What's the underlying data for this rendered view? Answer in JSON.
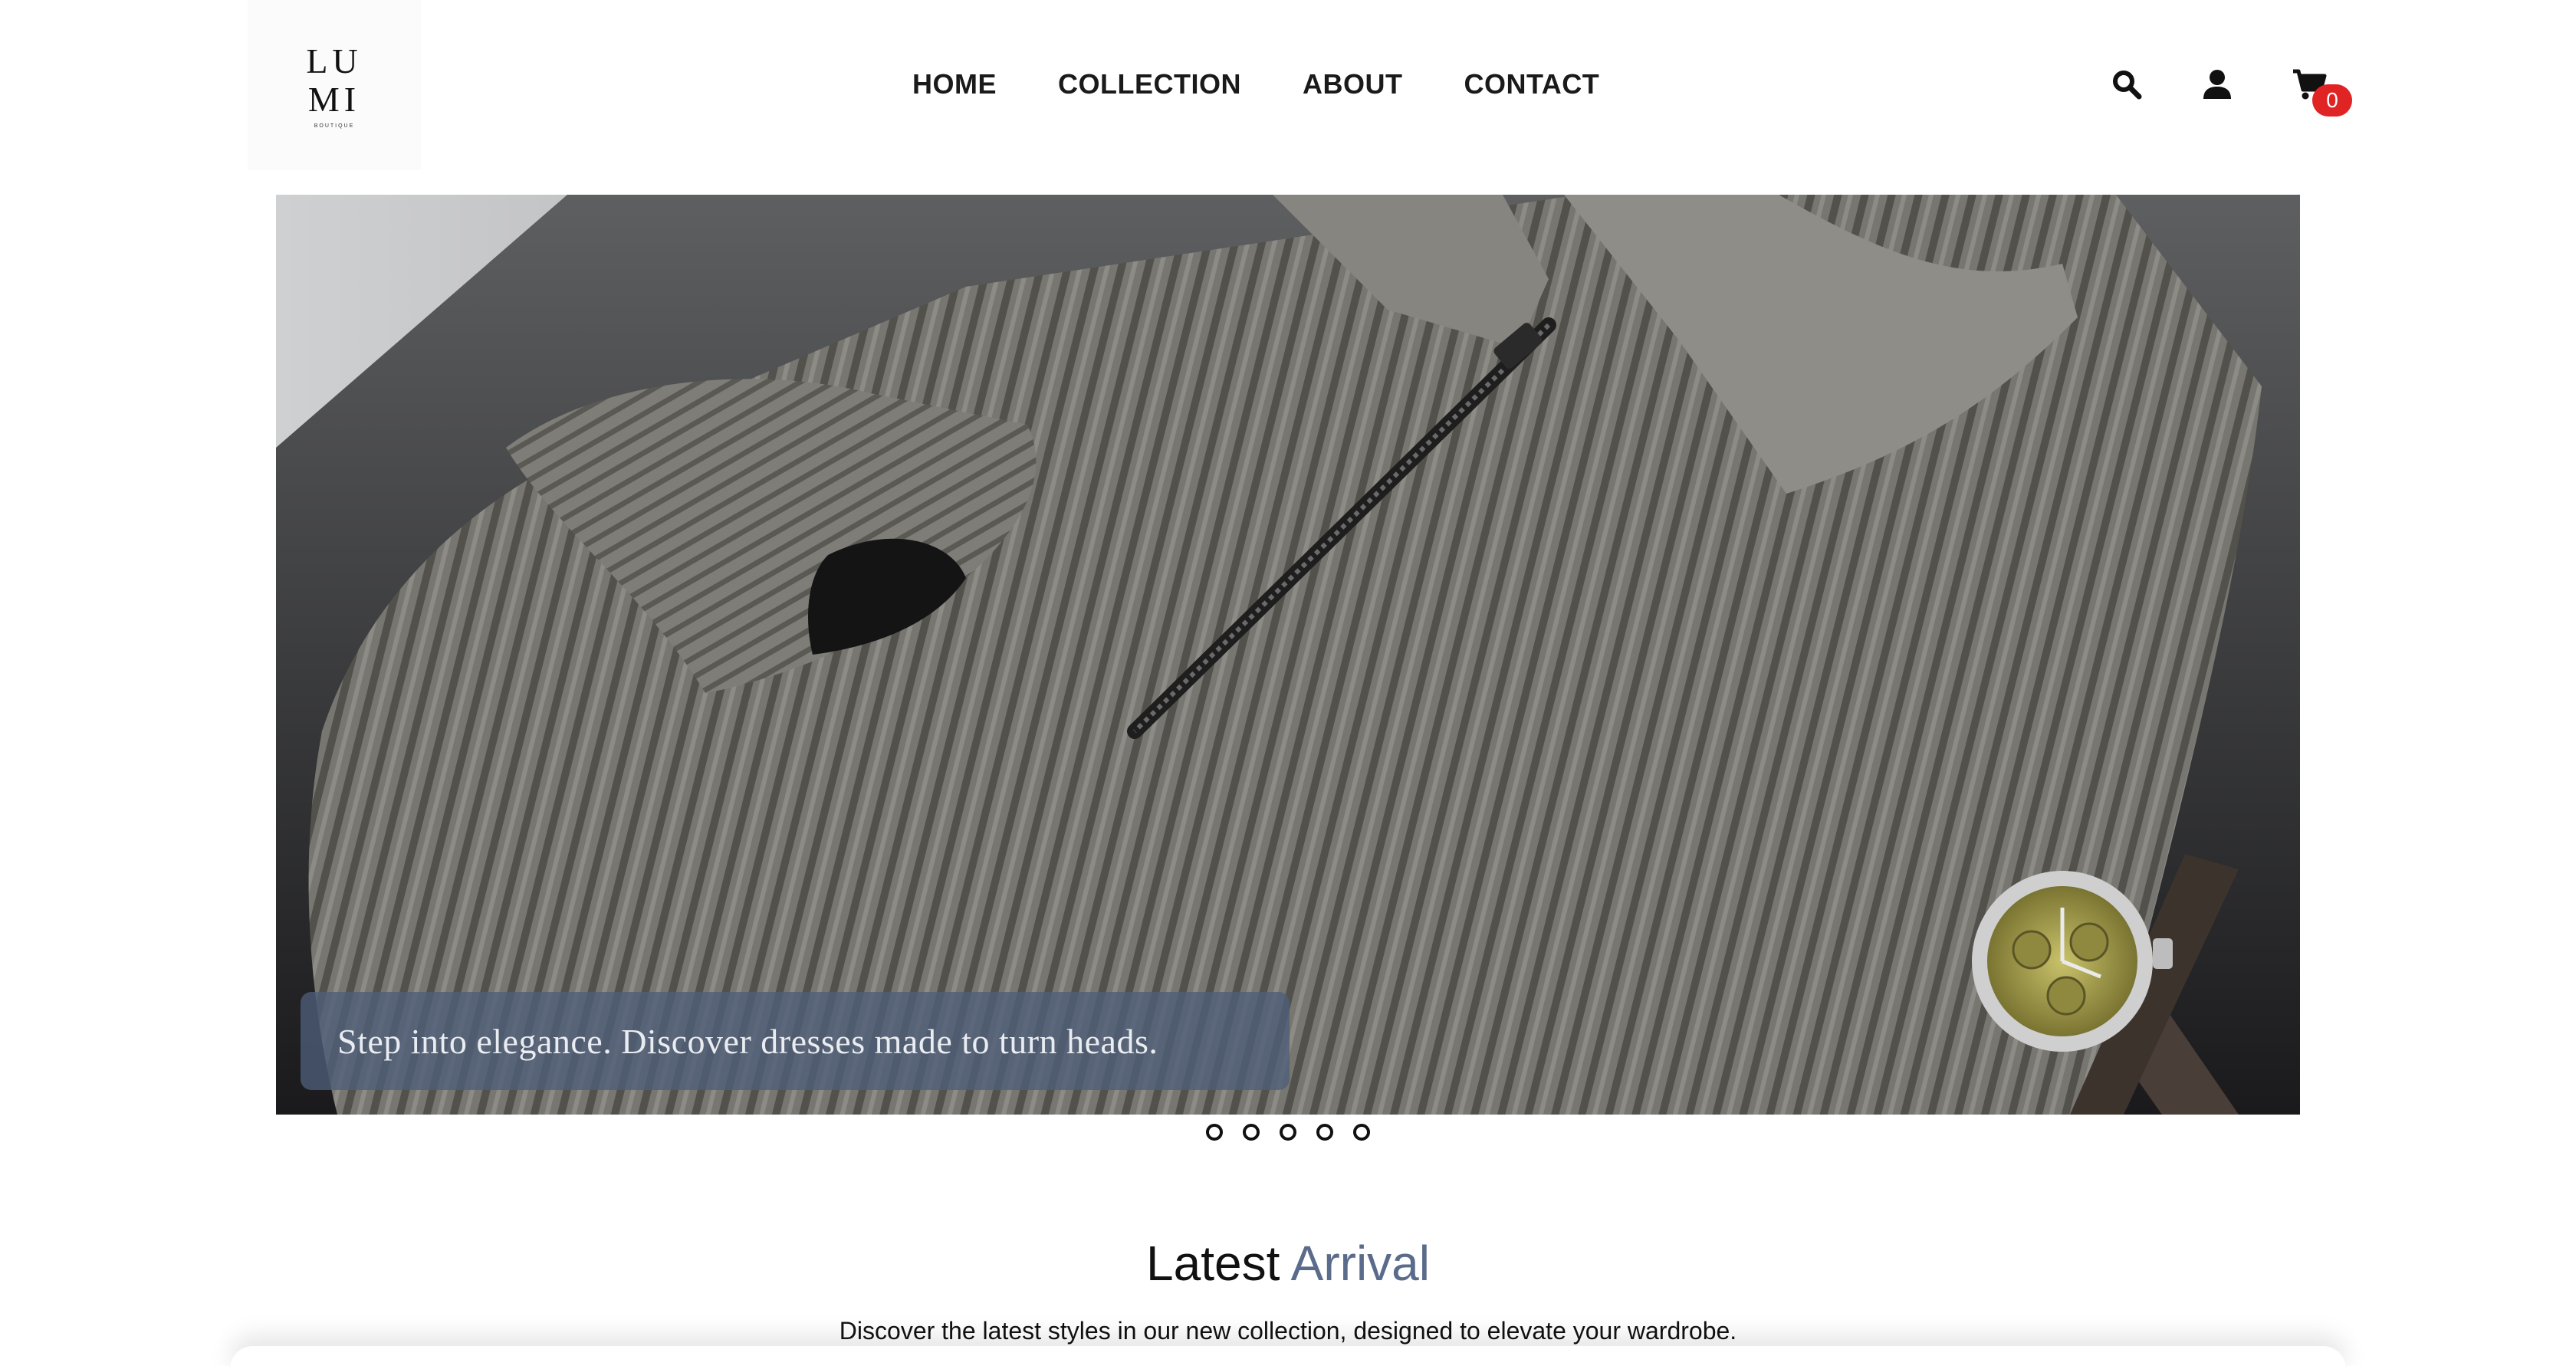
{
  "brand": {
    "logo_top": "LU",
    "logo_bottom": "MI",
    "logo_sub": "BOUTIQUE"
  },
  "nav": {
    "items": [
      {
        "label": "HOME"
      },
      {
        "label": "COLLECTION"
      },
      {
        "label": "ABOUT"
      },
      {
        "label": "CONTACT"
      }
    ]
  },
  "header_icons": {
    "search": "search-icon",
    "account": "user-icon",
    "cart": "cart-icon",
    "cart_count": "0"
  },
  "hero": {
    "caption": "Step into elegance. Discover dresses made to turn heads.",
    "slide_count": 5
  },
  "latest": {
    "title_main": "Latest",
    "title_accent": "Arrival",
    "subtitle": "Discover the latest styles in our new collection, designed to elevate your wardrobe."
  },
  "colors": {
    "accent": "#5a6b8c",
    "badge": "#e02424",
    "caption_bg": "#4e5e78"
  }
}
